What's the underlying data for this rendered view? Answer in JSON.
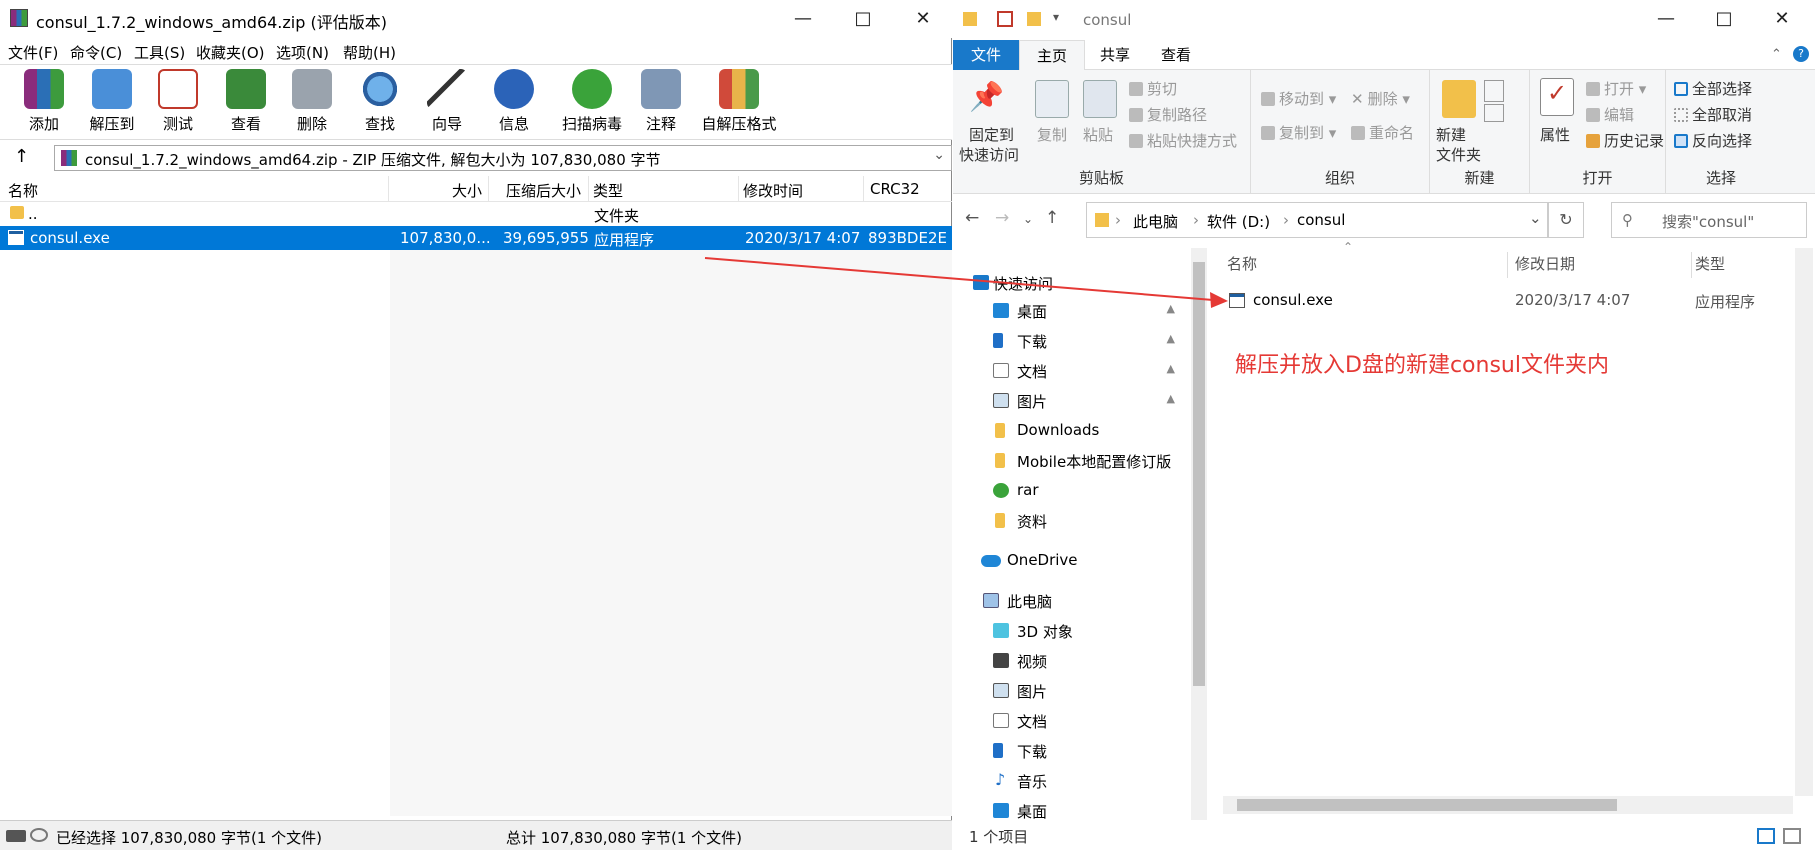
{
  "rar": {
    "title": "consul_1.7.2_windows_amd64.zip (评估版本)",
    "menu": [
      "文件(F)",
      "命令(C)",
      "工具(S)",
      "收藏夹(O)",
      "选项(N)",
      "帮助(H)"
    ],
    "toolbar": [
      "添加",
      "解压到",
      "测试",
      "查看",
      "删除",
      "查找",
      "向导",
      "信息",
      "扫描病毒",
      "注释",
      "自解压格式"
    ],
    "path": "consul_1.7.2_windows_amd64.zip - ZIP 压缩文件, 解包大小为 107,830,080 字节",
    "columns": {
      "name": "名称",
      "size": "大小",
      "packed": "压缩后大小",
      "type": "类型",
      "modified": "修改时间",
      "crc": "CRC32"
    },
    "rows": [
      {
        "name": "..",
        "size": "",
        "packed": "",
        "type": "文件夹",
        "modified": "",
        "crc": ""
      },
      {
        "name": "consul.exe",
        "size": "107,830,0...",
        "packed": "39,695,955",
        "type": "应用程序",
        "modified": "2020/3/17 4:07",
        "crc": "893BDE2E"
      }
    ],
    "status_left": "已经选择 107,830,080 字节(1 个文件)",
    "status_right": "总计 107,830,080 字节(1 个文件)"
  },
  "explorer": {
    "title": "consul",
    "tabs": [
      "文件",
      "主页",
      "共享",
      "查看"
    ],
    "ribbon": {
      "clipboard": {
        "label": "剪贴板",
        "pin": "固定到\n快速访问",
        "pin1": "固定到",
        "pin2": "快速访问",
        "copy": "复制",
        "paste": "粘贴",
        "cut": "剪切",
        "copy_path": "复制路径",
        "paste_shortcut": "粘贴快捷方式"
      },
      "organize": {
        "label": "组织",
        "move": "移动到",
        "copy_to": "复制到",
        "delete": "删除",
        "rename": "重命名"
      },
      "new": {
        "label": "新建",
        "folder1": "新建",
        "folder2": "文件夹"
      },
      "open": {
        "label": "打开",
        "properties": "属性",
        "open": "打开",
        "edit": "编辑",
        "history": "历史记录"
      },
      "select": {
        "label": "选择",
        "all": "全部选择",
        "none": "全部取消",
        "invert": "反向选择"
      }
    },
    "breadcrumb": [
      "此电脑",
      "软件 (D:)",
      "consul"
    ],
    "search_placeholder": "搜索\"consul\"",
    "nav": [
      {
        "label": "快速访问",
        "icon": "star-icon"
      },
      {
        "label": "桌面",
        "icon": "desktop-icon",
        "pinned": true
      },
      {
        "label": "下载",
        "icon": "download-icon",
        "pinned": true
      },
      {
        "label": "文档",
        "icon": "document-icon",
        "pinned": true
      },
      {
        "label": "图片",
        "icon": "pictures-icon",
        "pinned": true
      },
      {
        "label": "Downloads",
        "icon": "folder-icon"
      },
      {
        "label": "Mobile本地配置修订版",
        "icon": "folder-icon"
      },
      {
        "label": "rar",
        "icon": "rar-icon"
      },
      {
        "label": "资料",
        "icon": "folder-icon"
      },
      {
        "label": "OneDrive",
        "icon": "cloud-icon"
      },
      {
        "label": "此电脑",
        "icon": "computer-icon"
      },
      {
        "label": "3D 对象",
        "icon": "3d-icon"
      },
      {
        "label": "视频",
        "icon": "video-icon"
      },
      {
        "label": "图片",
        "icon": "pictures-icon"
      },
      {
        "label": "文档",
        "icon": "document-icon"
      },
      {
        "label": "下载",
        "icon": "download-icon"
      },
      {
        "label": "音乐",
        "icon": "music-icon"
      },
      {
        "label": "桌面",
        "icon": "desktop-icon"
      }
    ],
    "columns": {
      "name": "名称",
      "modified": "修改日期",
      "type": "类型"
    },
    "files": [
      {
        "name": "consul.exe",
        "modified": "2020/3/17 4:07",
        "type": "应用程序"
      }
    ],
    "status": "1 个项目"
  },
  "annotation": "解压并放入D盘的新建consul文件夹内",
  "colors": {
    "selection": "#0078d7",
    "annotation": "#e53935",
    "file_tab": "#1979ca"
  }
}
